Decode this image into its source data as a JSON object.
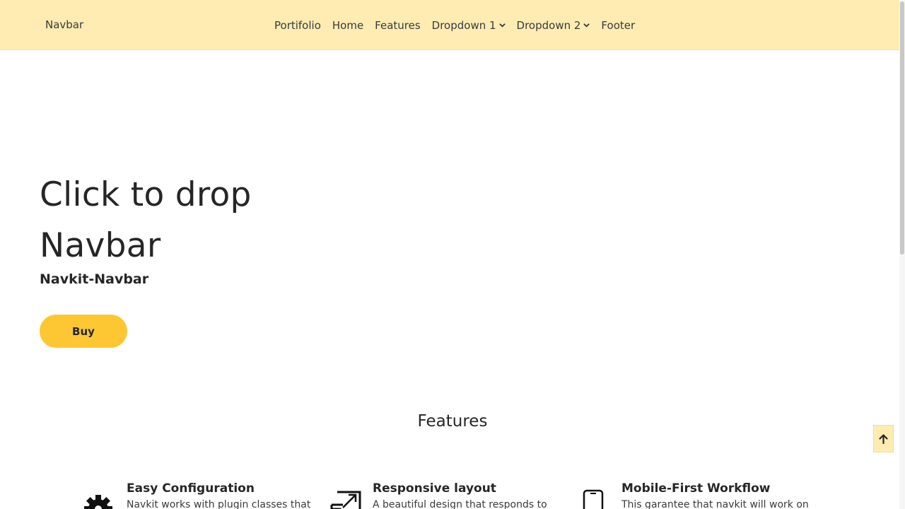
{
  "navbar": {
    "brand": "Navbar",
    "items": [
      {
        "label": "Portifolio"
      },
      {
        "label": "Home"
      },
      {
        "label": "Features"
      },
      {
        "label": "Dropdown 1",
        "has_dropdown": true
      },
      {
        "label": "Dropdown 2",
        "has_dropdown": true
      },
      {
        "label": "Footer"
      }
    ],
    "background_color": "#feecb3"
  },
  "hero": {
    "title_line1": "Click to drop",
    "title_line2": "Navbar",
    "subtitle": "Navkit-Navbar",
    "buy_label": "Buy",
    "accent_color": "#fcc733"
  },
  "features": {
    "heading": "Features",
    "items": [
      {
        "icon": "gear-icon",
        "title": "Easy Configuration",
        "description": "Navkit works with plugin classes that"
      },
      {
        "icon": "expand-icon",
        "title": "Responsive layout",
        "description": "A beautiful design that responds to"
      },
      {
        "icon": "mobile-icon",
        "title": "Mobile-First Workflow",
        "description": "This garantee that navkit will work on"
      }
    ]
  },
  "back_to_top": {
    "icon": "arrow-up-icon"
  }
}
